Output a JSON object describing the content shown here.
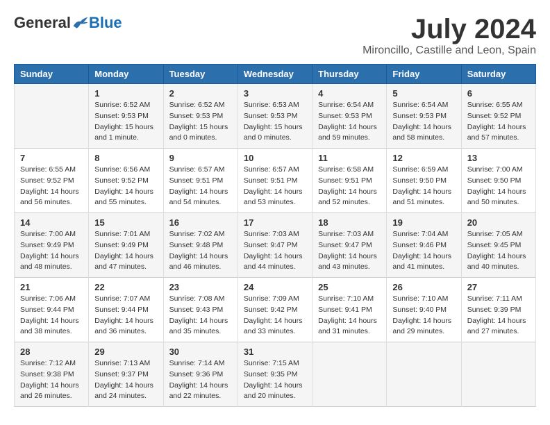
{
  "header": {
    "logo_general": "General",
    "logo_blue": "Blue",
    "month_year": "July 2024",
    "location": "Mironcillo, Castille and Leon, Spain"
  },
  "days_of_week": [
    "Sunday",
    "Monday",
    "Tuesday",
    "Wednesday",
    "Thursday",
    "Friday",
    "Saturday"
  ],
  "weeks": [
    [
      {
        "day": "",
        "content": ""
      },
      {
        "day": "1",
        "content": "Sunrise: 6:52 AM\nSunset: 9:53 PM\nDaylight: 15 hours\nand 1 minute."
      },
      {
        "day": "2",
        "content": "Sunrise: 6:52 AM\nSunset: 9:53 PM\nDaylight: 15 hours\nand 0 minutes."
      },
      {
        "day": "3",
        "content": "Sunrise: 6:53 AM\nSunset: 9:53 PM\nDaylight: 15 hours\nand 0 minutes."
      },
      {
        "day": "4",
        "content": "Sunrise: 6:54 AM\nSunset: 9:53 PM\nDaylight: 14 hours\nand 59 minutes."
      },
      {
        "day": "5",
        "content": "Sunrise: 6:54 AM\nSunset: 9:53 PM\nDaylight: 14 hours\nand 58 minutes."
      },
      {
        "day": "6",
        "content": "Sunrise: 6:55 AM\nSunset: 9:52 PM\nDaylight: 14 hours\nand 57 minutes."
      }
    ],
    [
      {
        "day": "7",
        "content": "Sunrise: 6:55 AM\nSunset: 9:52 PM\nDaylight: 14 hours\nand 56 minutes."
      },
      {
        "day": "8",
        "content": "Sunrise: 6:56 AM\nSunset: 9:52 PM\nDaylight: 14 hours\nand 55 minutes."
      },
      {
        "day": "9",
        "content": "Sunrise: 6:57 AM\nSunset: 9:51 PM\nDaylight: 14 hours\nand 54 minutes."
      },
      {
        "day": "10",
        "content": "Sunrise: 6:57 AM\nSunset: 9:51 PM\nDaylight: 14 hours\nand 53 minutes."
      },
      {
        "day": "11",
        "content": "Sunrise: 6:58 AM\nSunset: 9:51 PM\nDaylight: 14 hours\nand 52 minutes."
      },
      {
        "day": "12",
        "content": "Sunrise: 6:59 AM\nSunset: 9:50 PM\nDaylight: 14 hours\nand 51 minutes."
      },
      {
        "day": "13",
        "content": "Sunrise: 7:00 AM\nSunset: 9:50 PM\nDaylight: 14 hours\nand 50 minutes."
      }
    ],
    [
      {
        "day": "14",
        "content": "Sunrise: 7:00 AM\nSunset: 9:49 PM\nDaylight: 14 hours\nand 48 minutes."
      },
      {
        "day": "15",
        "content": "Sunrise: 7:01 AM\nSunset: 9:49 PM\nDaylight: 14 hours\nand 47 minutes."
      },
      {
        "day": "16",
        "content": "Sunrise: 7:02 AM\nSunset: 9:48 PM\nDaylight: 14 hours\nand 46 minutes."
      },
      {
        "day": "17",
        "content": "Sunrise: 7:03 AM\nSunset: 9:47 PM\nDaylight: 14 hours\nand 44 minutes."
      },
      {
        "day": "18",
        "content": "Sunrise: 7:03 AM\nSunset: 9:47 PM\nDaylight: 14 hours\nand 43 minutes."
      },
      {
        "day": "19",
        "content": "Sunrise: 7:04 AM\nSunset: 9:46 PM\nDaylight: 14 hours\nand 41 minutes."
      },
      {
        "day": "20",
        "content": "Sunrise: 7:05 AM\nSunset: 9:45 PM\nDaylight: 14 hours\nand 40 minutes."
      }
    ],
    [
      {
        "day": "21",
        "content": "Sunrise: 7:06 AM\nSunset: 9:44 PM\nDaylight: 14 hours\nand 38 minutes."
      },
      {
        "day": "22",
        "content": "Sunrise: 7:07 AM\nSunset: 9:44 PM\nDaylight: 14 hours\nand 36 minutes."
      },
      {
        "day": "23",
        "content": "Sunrise: 7:08 AM\nSunset: 9:43 PM\nDaylight: 14 hours\nand 35 minutes."
      },
      {
        "day": "24",
        "content": "Sunrise: 7:09 AM\nSunset: 9:42 PM\nDaylight: 14 hours\nand 33 minutes."
      },
      {
        "day": "25",
        "content": "Sunrise: 7:10 AM\nSunset: 9:41 PM\nDaylight: 14 hours\nand 31 minutes."
      },
      {
        "day": "26",
        "content": "Sunrise: 7:10 AM\nSunset: 9:40 PM\nDaylight: 14 hours\nand 29 minutes."
      },
      {
        "day": "27",
        "content": "Sunrise: 7:11 AM\nSunset: 9:39 PM\nDaylight: 14 hours\nand 27 minutes."
      }
    ],
    [
      {
        "day": "28",
        "content": "Sunrise: 7:12 AM\nSunset: 9:38 PM\nDaylight: 14 hours\nand 26 minutes."
      },
      {
        "day": "29",
        "content": "Sunrise: 7:13 AM\nSunset: 9:37 PM\nDaylight: 14 hours\nand 24 minutes."
      },
      {
        "day": "30",
        "content": "Sunrise: 7:14 AM\nSunset: 9:36 PM\nDaylight: 14 hours\nand 22 minutes."
      },
      {
        "day": "31",
        "content": "Sunrise: 7:15 AM\nSunset: 9:35 PM\nDaylight: 14 hours\nand 20 minutes."
      },
      {
        "day": "",
        "content": ""
      },
      {
        "day": "",
        "content": ""
      },
      {
        "day": "",
        "content": ""
      }
    ]
  ]
}
